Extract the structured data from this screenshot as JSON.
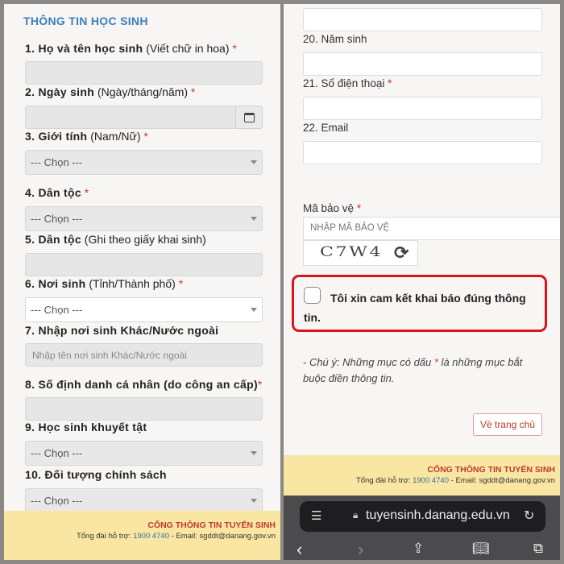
{
  "left": {
    "title": "THÔNG TIN HỌC SINH",
    "fields": [
      {
        "label": "1. Họ và tên học sinh",
        "hint": "(Viết chữ in hoa)",
        "required": true
      },
      {
        "label": "2. Ngày sinh",
        "hint": "(Ngày/tháng/năm)",
        "required": true
      },
      {
        "label": "3. Giới tính",
        "hint": "(Nam/Nữ)",
        "required": true,
        "value": "--- Chọn ---"
      },
      {
        "label": "4. Dân tộc",
        "hint": "",
        "required": true,
        "value": "--- Chọn ---"
      },
      {
        "label": "5. Dân tộc",
        "hint": "(Ghi theo giấy khai sinh)",
        "required": false
      },
      {
        "label": "6. Nơi sinh",
        "hint": "(Tỉnh/Thành phố)",
        "required": true,
        "value": "--- Chọn ---"
      },
      {
        "label": "7. Nhập nơi sinh Khác/Nước ngoài",
        "hint": "",
        "required": false,
        "placeholder": "Nhập tên nơi sinh Khác/Nước ngoài"
      },
      {
        "label": "8. Số định danh cá nhân (do công an cấp)",
        "hint": "",
        "required": true
      },
      {
        "label": "9. Học sinh khuyết tật",
        "hint": "",
        "required": false,
        "value": "--- Chọn ---"
      },
      {
        "label": "10. Đối tượng chính sách",
        "hint": "",
        "required": false,
        "value": "--- Chọn ---"
      }
    ],
    "required_mark": "*"
  },
  "right": {
    "fields": [
      {
        "label": "20. Năm sinh"
      },
      {
        "label": "21. Số điện thoại",
        "required": true
      },
      {
        "label": "22. Email"
      }
    ],
    "captcha_label": "Mã bảo vệ",
    "captcha_placeholder": "NHẬP MÃ BẢO VỆ",
    "captcha_code": "C7W4",
    "commit_text": "Tôi xin cam kết khai báo đúng thông tin.",
    "commit_checked": false,
    "note_prefix": "- Chú ý: Những mục có dấu ",
    "note_suffix": " là những mục bắt buộc điền thông tin.",
    "home_button": "Về trang chủ",
    "highlight_color": "#d9141b"
  },
  "footer": {
    "title": "CỔNG THÔNG TIN TUYỂN SINH",
    "support_prefix": "Tổng đài hỗ trợ: ",
    "phone": "1900 4740",
    "email_text": " - Email: sgddt@danang.gov.vn"
  },
  "browser": {
    "url": "tuyensinh.danang.edu.vn"
  }
}
